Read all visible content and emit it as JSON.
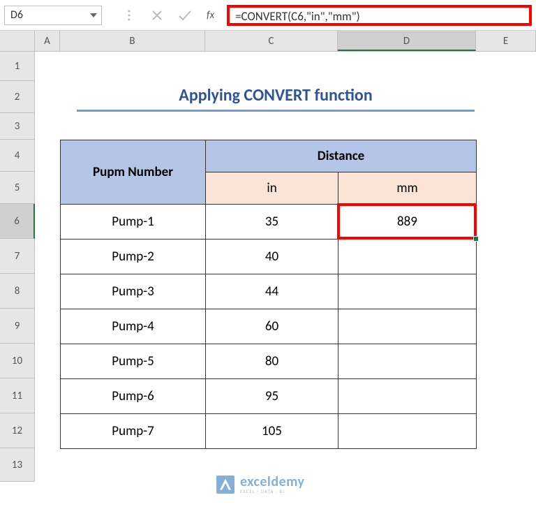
{
  "nameBox": "D6",
  "formula": "=CONVERT(C6,\"in\",\"mm\")",
  "fxLabel": "fx",
  "columns": [
    "A",
    "B",
    "C",
    "D",
    "E"
  ],
  "rows": [
    "1",
    "2",
    "3",
    "4",
    "5",
    "6",
    "7",
    "8",
    "9",
    "10",
    "11",
    "12",
    "13"
  ],
  "activeCol": "D",
  "activeRow": "6",
  "title": "Applying CONVERT function",
  "table": {
    "header1": "Pupm Number",
    "header2": "Distance",
    "colIn": "in",
    "colMm": "mm",
    "rows": [
      {
        "name": "Pump-1",
        "in": "35",
        "mm": "889"
      },
      {
        "name": "Pump-2",
        "in": "40",
        "mm": ""
      },
      {
        "name": "Pump-3",
        "in": "44",
        "mm": ""
      },
      {
        "name": "Pump-4",
        "in": "60",
        "mm": ""
      },
      {
        "name": "Pump-5",
        "in": "80",
        "mm": ""
      },
      {
        "name": "Pump-6",
        "in": "95",
        "mm": ""
      },
      {
        "name": "Pump-7",
        "in": "105",
        "mm": ""
      }
    ]
  },
  "watermark": {
    "main": "exceldemy",
    "sub": "EXCEL · DATA · BI"
  }
}
